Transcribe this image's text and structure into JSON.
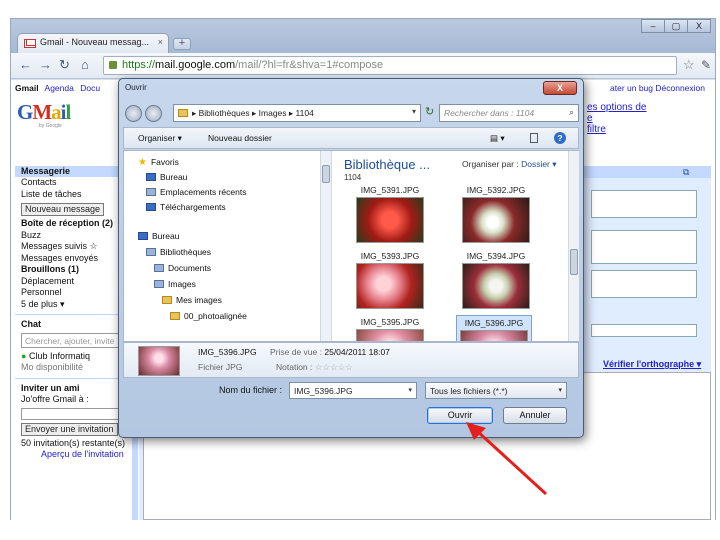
{
  "browser": {
    "tab_title": "Gmail - Nouveau messag...",
    "tab_close": "×",
    "newtab": "+",
    "window_controls": [
      "–",
      "▢",
      "X"
    ],
    "url_https": "https://",
    "url_host": "mail.google.com",
    "url_path": "/mail/?hl=fr&shva=1#compose"
  },
  "gmail": {
    "topnav_brand": "Gmail",
    "topnav": [
      "Agenda",
      "Docu"
    ],
    "topright": "ater un bug  Déconnexion",
    "logo": {
      "l1": "G",
      "l2": "M",
      "l3": "a",
      "l4": "i",
      "l5": "l",
      "sub": "by Google"
    },
    "options_links": [
      "es options de",
      "e",
      "filtre"
    ],
    "sidebar": {
      "header": "Messagerie",
      "items_top": [
        "Contacts",
        "Liste de tâches"
      ],
      "new_message": "Nouveau message",
      "inbox": "Boîte de réception (2)",
      "buzz": "Buzz",
      "followed": "Messages suivis ☆",
      "sent": "Messages envoyés",
      "drafts": "Brouillons (1)",
      "labels": [
        "Déplacement",
        "Personnel"
      ],
      "more": "5 de plus ▾",
      "chat_header": "Chat",
      "chat_placeholder": "Chercher, ajouter, invite",
      "chat_user": "Club Informatiq",
      "chat_status": "Mo disponibilité",
      "invite_header": "Inviter un ami",
      "invite_sub": "Jo'offre Gmail à :",
      "invite_button": "Envoyer une invitation",
      "invites_left": "50 invitation(s) restante(s)",
      "invite_preview": "Aperçu de l'invitation"
    },
    "spellcheck": "Vérifier l'orthographe ▾"
  },
  "dialog": {
    "title": "Ouvrir",
    "close": "X",
    "breadcrumb": "▸  Bibliothèques  ▸  Images  ▸  1104",
    "breadcrumb_arrow": "▾",
    "search_placeholder": "Rechercher dans : 1104",
    "tools": {
      "organize": "Organiser ▾",
      "new_folder": "Nouveau dossier",
      "view": "▤ ▾",
      "help": "?"
    },
    "tree": [
      {
        "label": "Favoris",
        "icon": "star"
      },
      {
        "label": "Bureau",
        "icon": "blue"
      },
      {
        "label": "Emplacements récents",
        "icon": "lib"
      },
      {
        "label": "Téléchargements",
        "icon": "blue"
      },
      {
        "label": "Bureau",
        "icon": "blue"
      },
      {
        "label": "Bibliothèques",
        "icon": "lib"
      },
      {
        "label": "Documents",
        "icon": "lib"
      },
      {
        "label": "Images",
        "icon": "lib"
      },
      {
        "label": "Mes images",
        "icon": "fold"
      },
      {
        "label": "00_photoalignée",
        "icon": "fold"
      }
    ],
    "content_title": "Bibliothèque ...",
    "content_sub": "1104",
    "arrange_label": "Organiser par :",
    "arrange_value": "Dossier ▾",
    "thumbnails": [
      {
        "label": "IMG_5391.JPG",
        "color": "#b22a26",
        "top": true
      },
      {
        "label": "IMG_5392.JPG",
        "color": "#5b2a2a",
        "top": true
      },
      {
        "label": "IMG_5393.JPG",
        "color": "#c0392b"
      },
      {
        "label": "IMG_5394.JPG",
        "color": "#6d4b3a"
      },
      {
        "label": "IMG_5395.JPG",
        "color": "#d98ba0"
      },
      {
        "label": "IMG_5396.JPG",
        "color": "#c77d96",
        "selected": true
      }
    ],
    "details": {
      "name": "IMG_5396.JPG",
      "date_label": "Prise de vue :",
      "date_value": "25/04/2011 18:07",
      "type": "Fichier JPG",
      "rating_label": "Notation :",
      "rating_value": "☆☆☆☆☆"
    },
    "filename_label": "Nom du fichier :",
    "filename_value": "IMG_5396.JPG",
    "filetype_value": "Tous les fichiers (*.*)",
    "dropdown_arrow": "▾",
    "open_label": "Ouvrir",
    "cancel_label": "Annuler"
  },
  "colors": {
    "annotation_arrow": "#e3201b",
    "gmail_blue": "#c3d9ff"
  }
}
